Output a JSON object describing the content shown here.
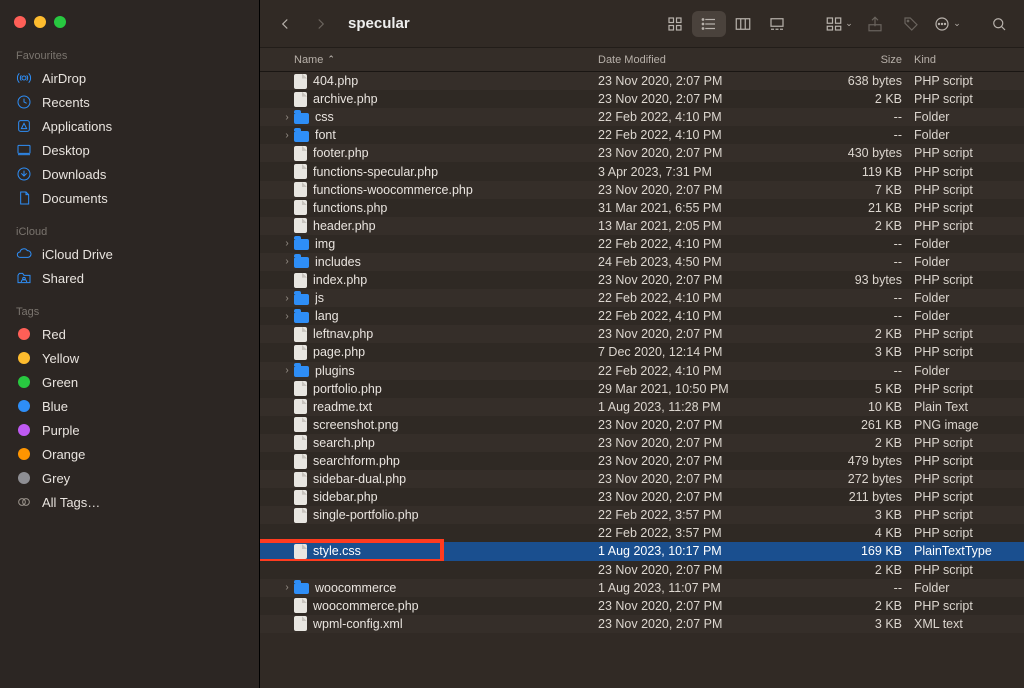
{
  "window_title": "specular",
  "traffic": [
    "close",
    "minimize",
    "zoom"
  ],
  "sidebar": {
    "sections": [
      {
        "title": "Favourites",
        "items": [
          {
            "label": "AirDrop",
            "icon": "airdrop"
          },
          {
            "label": "Recents",
            "icon": "clock"
          },
          {
            "label": "Applications",
            "icon": "apps"
          },
          {
            "label": "Desktop",
            "icon": "desktop"
          },
          {
            "label": "Downloads",
            "icon": "downloads"
          },
          {
            "label": "Documents",
            "icon": "documents"
          }
        ]
      },
      {
        "title": "iCloud",
        "items": [
          {
            "label": "iCloud Drive",
            "icon": "cloud"
          },
          {
            "label": "Shared",
            "icon": "shared"
          }
        ]
      },
      {
        "title": "Tags",
        "items": [
          {
            "label": "Red",
            "color": "#ff5f57"
          },
          {
            "label": "Yellow",
            "color": "#febc2e"
          },
          {
            "label": "Green",
            "color": "#28c840"
          },
          {
            "label": "Blue",
            "color": "#2e8ef7"
          },
          {
            "label": "Purple",
            "color": "#bf5af2"
          },
          {
            "label": "Orange",
            "color": "#ff9500"
          },
          {
            "label": "Grey",
            "color": "#8e8e93"
          },
          {
            "label": "All Tags…",
            "icon": "alltags"
          }
        ]
      }
    ]
  },
  "columns": {
    "name": "Name",
    "date": "Date Modified",
    "size": "Size",
    "kind": "Kind"
  },
  "files": [
    {
      "name": "404.php",
      "date": "23 Nov 2020, 2:07 PM",
      "size": "638 bytes",
      "kind": "PHP script",
      "type": "doc"
    },
    {
      "name": "archive.php",
      "date": "23 Nov 2020, 2:07 PM",
      "size": "2 KB",
      "kind": "PHP script",
      "type": "doc"
    },
    {
      "name": "css",
      "date": "22 Feb 2022, 4:10 PM",
      "size": "--",
      "kind": "Folder",
      "type": "folder"
    },
    {
      "name": "font",
      "date": "22 Feb 2022, 4:10 PM",
      "size": "--",
      "kind": "Folder",
      "type": "folder"
    },
    {
      "name": "footer.php",
      "date": "23 Nov 2020, 2:07 PM",
      "size": "430 bytes",
      "kind": "PHP script",
      "type": "doc"
    },
    {
      "name": "functions-specular.php",
      "date": "3 Apr 2023, 7:31 PM",
      "size": "119 KB",
      "kind": "PHP script",
      "type": "doc"
    },
    {
      "name": "functions-woocommerce.php",
      "date": "23 Nov 2020, 2:07 PM",
      "size": "7 KB",
      "kind": "PHP script",
      "type": "doc"
    },
    {
      "name": "functions.php",
      "date": "31 Mar 2021, 6:55 PM",
      "size": "21 KB",
      "kind": "PHP script",
      "type": "doc"
    },
    {
      "name": "header.php",
      "date": "13 Mar 2021, 2:05 PM",
      "size": "2 KB",
      "kind": "PHP script",
      "type": "doc"
    },
    {
      "name": "img",
      "date": "22 Feb 2022, 4:10 PM",
      "size": "--",
      "kind": "Folder",
      "type": "folder"
    },
    {
      "name": "includes",
      "date": "24 Feb 2023, 4:50 PM",
      "size": "--",
      "kind": "Folder",
      "type": "folder"
    },
    {
      "name": "index.php",
      "date": "23 Nov 2020, 2:07 PM",
      "size": "93 bytes",
      "kind": "PHP script",
      "type": "doc"
    },
    {
      "name": "js",
      "date": "22 Feb 2022, 4:10 PM",
      "size": "--",
      "kind": "Folder",
      "type": "folder"
    },
    {
      "name": "lang",
      "date": "22 Feb 2022, 4:10 PM",
      "size": "--",
      "kind": "Folder",
      "type": "folder"
    },
    {
      "name": "leftnav.php",
      "date": "23 Nov 2020, 2:07 PM",
      "size": "2 KB",
      "kind": "PHP script",
      "type": "doc"
    },
    {
      "name": "page.php",
      "date": "7 Dec 2020, 12:14 PM",
      "size": "3 KB",
      "kind": "PHP script",
      "type": "doc"
    },
    {
      "name": "plugins",
      "date": "22 Feb 2022, 4:10 PM",
      "size": "--",
      "kind": "Folder",
      "type": "folder"
    },
    {
      "name": "portfolio.php",
      "date": "29 Mar 2021, 10:50 PM",
      "size": "5 KB",
      "kind": "PHP script",
      "type": "doc"
    },
    {
      "name": "readme.txt",
      "date": "1 Aug 2023, 11:28 PM",
      "size": "10 KB",
      "kind": "Plain Text",
      "type": "doc"
    },
    {
      "name": "screenshot.png",
      "date": "23 Nov 2020, 2:07 PM",
      "size": "261 KB",
      "kind": "PNG image",
      "type": "doc"
    },
    {
      "name": "search.php",
      "date": "23 Nov 2020, 2:07 PM",
      "size": "2 KB",
      "kind": "PHP script",
      "type": "doc"
    },
    {
      "name": "searchform.php",
      "date": "23 Nov 2020, 2:07 PM",
      "size": "479 bytes",
      "kind": "PHP script",
      "type": "doc"
    },
    {
      "name": "sidebar-dual.php",
      "date": "23 Nov 2020, 2:07 PM",
      "size": "272 bytes",
      "kind": "PHP script",
      "type": "doc"
    },
    {
      "name": "sidebar.php",
      "date": "23 Nov 2020, 2:07 PM",
      "size": "211 bytes",
      "kind": "PHP script",
      "type": "doc"
    },
    {
      "name": "single-portfolio.php",
      "date": "22 Feb 2022, 3:57 PM",
      "size": "3 KB",
      "kind": "PHP script",
      "type": "doc"
    },
    {
      "name": "",
      "date": "22 Feb 2022, 3:57 PM",
      "size": "4 KB",
      "kind": "PHP script",
      "type": "doc",
      "obscured": true
    },
    {
      "name": "style.css",
      "date": "1 Aug 2023, 10:17 PM",
      "size": "169 KB",
      "kind": "PlainTextType",
      "type": "doc",
      "selected": true,
      "highlight": true
    },
    {
      "name": "",
      "date": "23 Nov 2020, 2:07 PM",
      "size": "2 KB",
      "kind": "PHP script",
      "type": "doc",
      "obscured": true
    },
    {
      "name": "woocommerce",
      "date": "1 Aug 2023, 11:07 PM",
      "size": "--",
      "kind": "Folder",
      "type": "folder"
    },
    {
      "name": "woocommerce.php",
      "date": "23 Nov 2020, 2:07 PM",
      "size": "2 KB",
      "kind": "PHP script",
      "type": "doc"
    },
    {
      "name": "wpml-config.xml",
      "date": "23 Nov 2020, 2:07 PM",
      "size": "3 KB",
      "kind": "XML text",
      "type": "doc"
    }
  ]
}
